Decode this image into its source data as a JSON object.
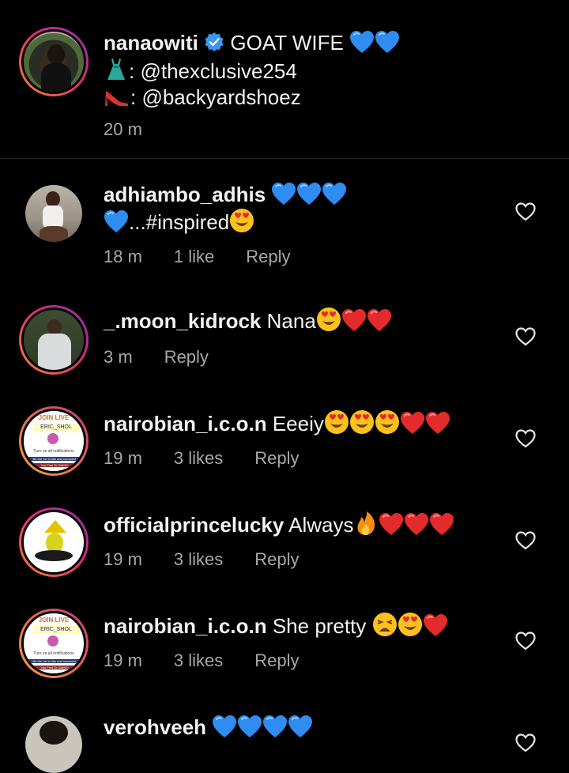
{
  "caption": {
    "username": "nanaowiti",
    "text": "GOAT WIFE",
    "line2": ": @thexclusive254",
    "line3": ": @backyardshoez",
    "time": "20 m"
  },
  "comments": [
    {
      "username": "adhiambo_adhis",
      "text_before": "",
      "text_line2": "...#inspired",
      "time": "18 m",
      "likes": "1 like",
      "reply": "Reply"
    },
    {
      "username": "_.moon_kidrock",
      "text": "Nana",
      "time": "3 m",
      "reply": "Reply"
    },
    {
      "username": "nairobian_i.c.o.n",
      "text": "Eeeiy",
      "time": "19 m",
      "likes": "3 likes",
      "reply": "Reply"
    },
    {
      "username": "officialprincelucky",
      "text": "Always",
      "time": "19 m",
      "likes": "3 likes",
      "reply": "Reply"
    },
    {
      "username": "nairobian_i.c.o.n",
      "text": "She pretty",
      "time": "19 m",
      "likes": "3 likes",
      "reply": "Reply"
    },
    {
      "username": "verohveeh"
    }
  ],
  "avatar_badge": {
    "line1": "JOIN LIVE",
    "line2": "ERIC_SHOL",
    "line3": "Turn on all notifications",
    "line4": "Be the 1st to like and comment",
    "line5": "You First To GAIN!!!"
  },
  "colors": {
    "background": "#000000",
    "meta": "#a8a8a8",
    "verified": "#3897f0"
  }
}
